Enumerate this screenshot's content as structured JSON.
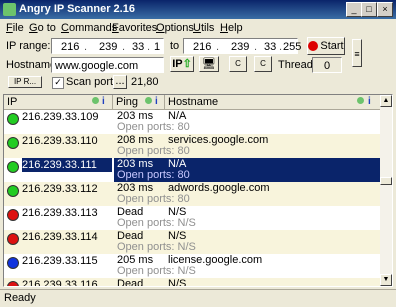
{
  "window": {
    "title": "Angry IP Scanner 2.16",
    "min": "_",
    "max": "□",
    "close": "×"
  },
  "menu": [
    {
      "u": "F",
      "rest": "ile"
    },
    {
      "u": "G",
      "rest": "o to"
    },
    {
      "u": "C",
      "rest": "ommands"
    },
    {
      "u": "F",
      "rest": "avorites"
    },
    {
      "u": "O",
      "rest": "ptions"
    },
    {
      "u": "U",
      "rest": "tils"
    },
    {
      "u": "H",
      "rest": "elp"
    }
  ],
  "toolbar": {
    "ip_range_label": "IP range:",
    "ip_from": [
      "216",
      "239",
      "33",
      "1"
    ],
    "to_label": "to",
    "ip_to": [
      "216",
      "239",
      "33",
      "255"
    ],
    "start_label": "Start",
    "hostname_label": "Hostname:",
    "hostname_value": "www.google.com",
    "ip_btn": "IP",
    "threads_label": "Threads",
    "threads_value": "0",
    "range_btn": "IP R...",
    "scan_ports_label": "Scan ports",
    "ports_btn": "...",
    "ports_value": "21,80"
  },
  "columns": [
    "IP",
    "Ping",
    "Hostname"
  ],
  "rows": [
    {
      "ip": "216.239.33.109",
      "ping": "203 ms",
      "host": "N/A",
      "ports": "Open ports: 80",
      "status": "green"
    },
    {
      "ip": "216.239.33.110",
      "ping": "208 ms",
      "host": "services.google.com",
      "ports": "Open ports: 80",
      "status": "green"
    },
    {
      "ip": "216.239.33.111",
      "ping": "203 ms",
      "host": "N/A",
      "ports": "Open ports: 80",
      "status": "green"
    },
    {
      "ip": "216.239.33.112",
      "ping": "203 ms",
      "host": "adwords.google.com",
      "ports": "Open ports: 80",
      "status": "green"
    },
    {
      "ip": "216.239.33.113",
      "ping": "Dead",
      "host": "N/S",
      "ports": "Open ports: N/S",
      "status": "red"
    },
    {
      "ip": "216.239.33.114",
      "ping": "Dead",
      "host": "N/S",
      "ports": "Open ports: N/S",
      "status": "red"
    },
    {
      "ip": "216.239.33.115",
      "ping": "205 ms",
      "host": "license.google.com",
      "ports": "Open ports: N/S",
      "status": "blue"
    },
    {
      "ip": "216.239.33.116",
      "ping": "Dead",
      "host": "N/S",
      "ports": "",
      "status": "red"
    }
  ],
  "status": {
    "text": "Ready"
  },
  "colors": {
    "green": "#22cc22",
    "red": "#dd1111",
    "blue": "#1133dd",
    "selection": "#0a246a"
  }
}
